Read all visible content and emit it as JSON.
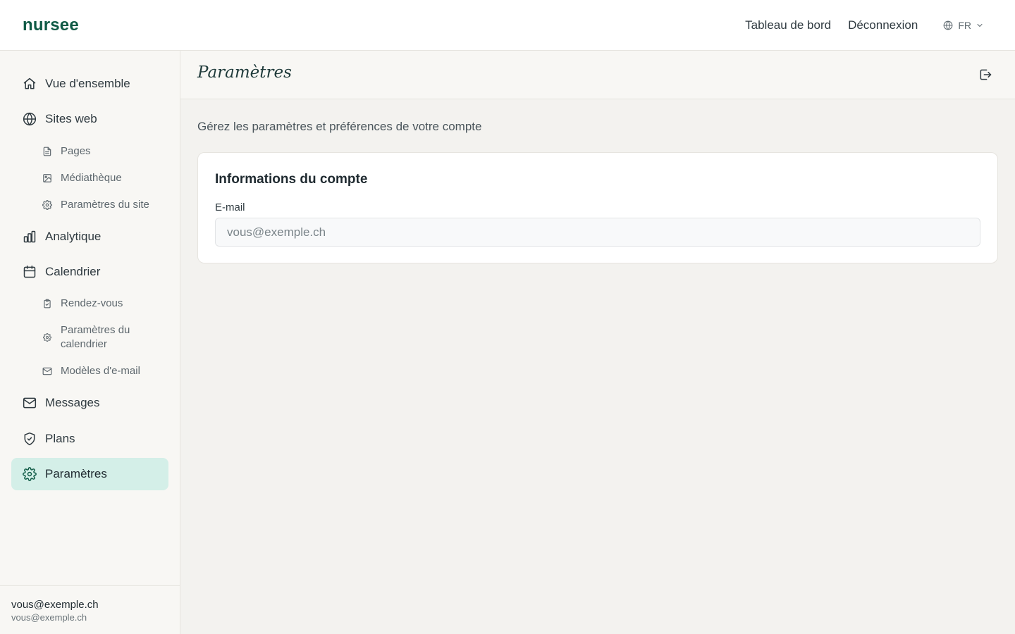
{
  "app": {
    "logo": "nursee",
    "brand_color": "#0f5a45",
    "active_color": "#d4efe8"
  },
  "topnav": {
    "dashboard": "Tableau de bord",
    "logout": "Déconnexion",
    "language": "FR",
    "language_icon": "globe-icon"
  },
  "sidebar": {
    "items": {
      "overview": {
        "label": "Vue d'ensemble",
        "icon": "home-icon"
      },
      "websites": {
        "label": "Sites web",
        "icon": "globe-icon"
      },
      "pages": {
        "label": "Pages",
        "icon": "file-icon"
      },
      "media": {
        "label": "Médiathèque",
        "icon": "image-icon"
      },
      "site_settings": {
        "label": "Paramètres du site",
        "icon": "gear-icon"
      },
      "analytics": {
        "label": "Analytique",
        "icon": "bar-chart-icon"
      },
      "calendar": {
        "label": "Calendrier",
        "icon": "calendar-icon"
      },
      "appointments": {
        "label": "Rendez-vous",
        "icon": "clipboard-icon"
      },
      "calendar_settings": {
        "label": "Paramètres du calendrier",
        "icon": "gear-icon"
      },
      "email_templates": {
        "label": "Modèles d'e-mail",
        "icon": "mail-icon"
      },
      "messages": {
        "label": "Messages",
        "icon": "mail-icon"
      },
      "plans": {
        "label": "Plans",
        "icon": "shield-icon"
      },
      "settings": {
        "label": "Paramètres",
        "icon": "gear-icon",
        "active": true
      }
    },
    "footer": {
      "name": "vous@exemple.ch",
      "email": "vous@exemple.ch"
    }
  },
  "page": {
    "title": "Paramètres",
    "subtitle": "Gérez les paramètres et préférences de votre compte",
    "logout_icon": "logout-icon"
  },
  "account_card": {
    "title": "Informations du compte",
    "email_label": "E-mail",
    "email_placeholder": "vous@exemple.ch",
    "email_value": ""
  }
}
